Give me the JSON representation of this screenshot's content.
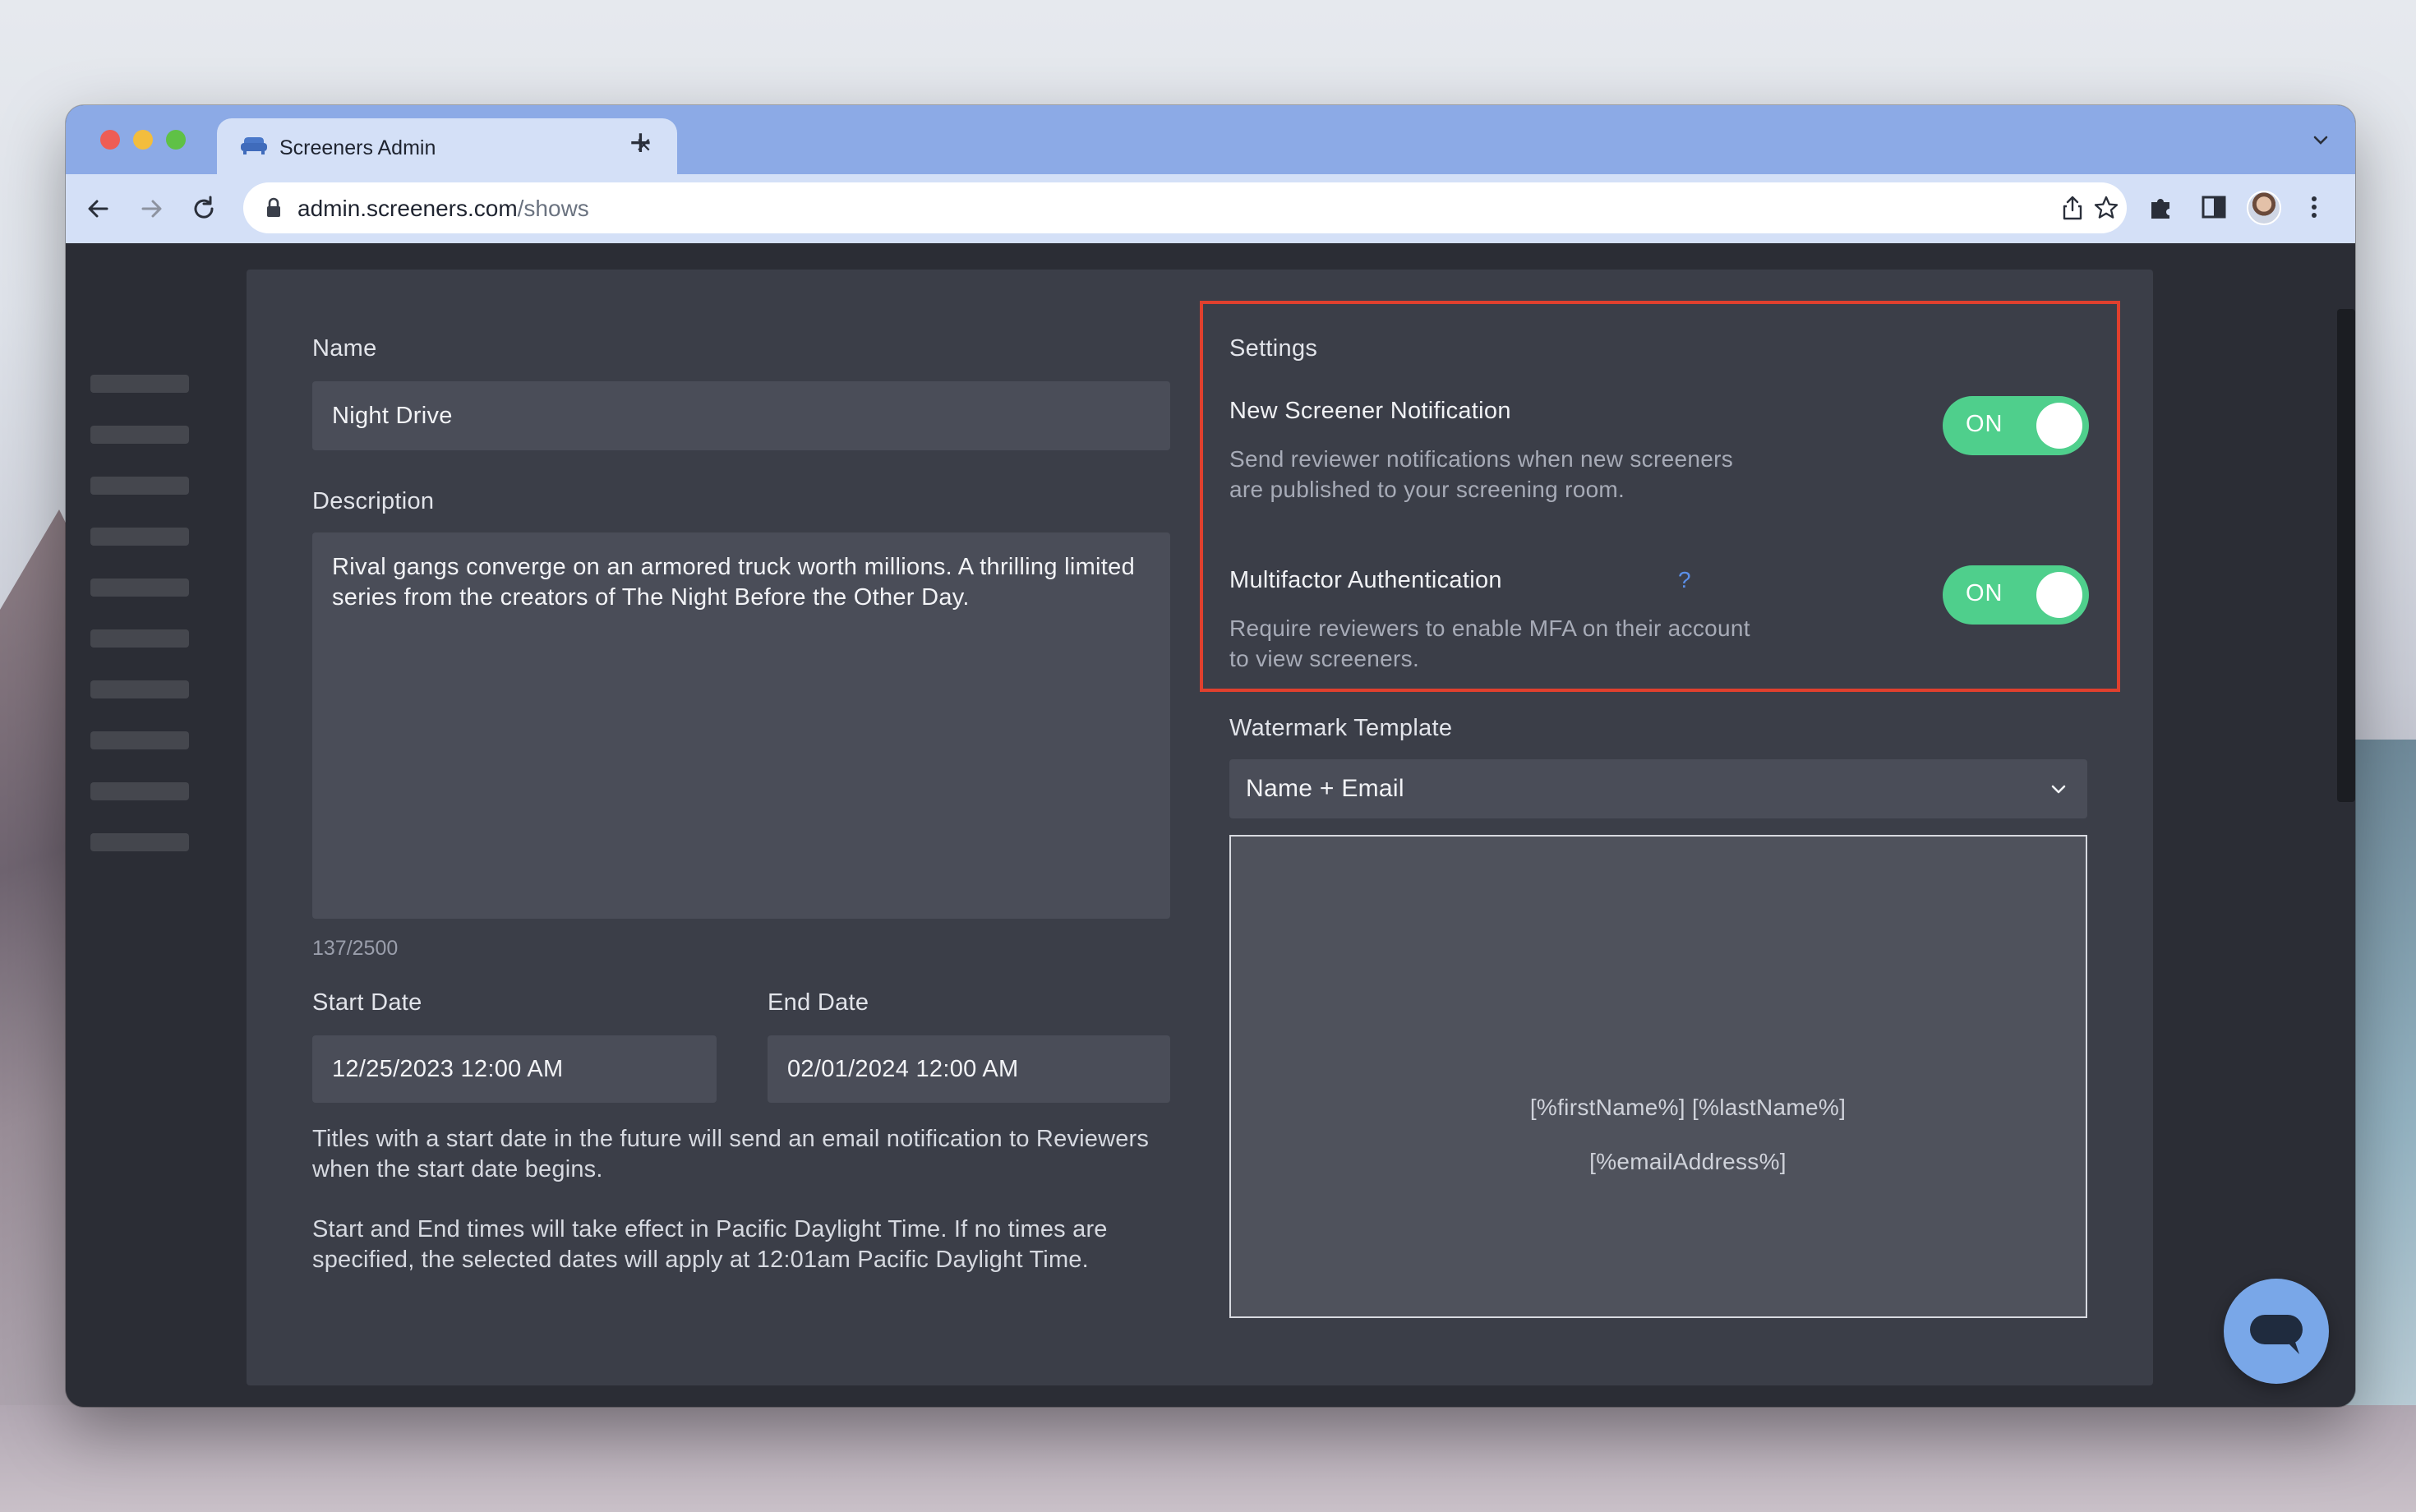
{
  "browser": {
    "tab_title": "Screeners Admin",
    "url_host": "admin.screeners.com",
    "url_path": "/shows"
  },
  "form": {
    "name_label": "Name",
    "name_value": "Night Drive",
    "description_label": "Description",
    "description_value": "Rival gangs converge on an armored truck worth millions. A thrilling limited series from the creators of The Night Before the Other Day.",
    "char_count": "137/2500",
    "start_label": "Start Date",
    "start_value": "12/25/2023 12:00 AM",
    "end_label": "End Date",
    "end_value": "02/01/2024 12:00 AM",
    "help_1": "Titles with a start date in the future will send an email notification to Reviewers when the start date begins.",
    "help_2": "Start and End times will take effect in Pacific Daylight Time. If no times are specified, the selected dates will apply at 12:01am Pacific Daylight Time."
  },
  "settings": {
    "title": "Settings",
    "notification": {
      "title": "New Screener Notification",
      "desc": "Send reviewer notifications when new screeners are published to your screening room.",
      "toggle": "ON"
    },
    "mfa": {
      "title": "Multifactor Authentication",
      "help": "?",
      "desc": "Require reviewers to enable MFA on their account to view screeners.",
      "toggle": "ON"
    }
  },
  "watermark": {
    "label": "Watermark Template",
    "selected": "Name + Email",
    "preview_line1": "[%firstName%] [%lastName%]",
    "preview_line2": "[%emailAddress%]"
  },
  "colors": {
    "accent_toggle": "#4fcf8c",
    "highlight_box": "#e0402e",
    "chat_button": "#79a7e8"
  }
}
